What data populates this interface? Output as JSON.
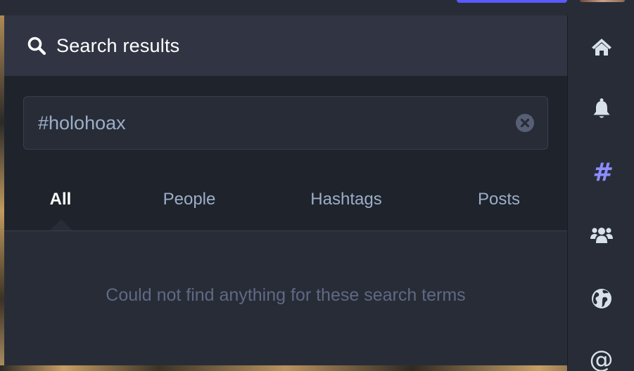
{
  "header": {
    "title": "Search results",
    "icon": "search-icon"
  },
  "search": {
    "value": "#holohoax",
    "clear_icon": "clear-icon"
  },
  "tabs": [
    {
      "label": "All",
      "active": true
    },
    {
      "label": "People",
      "active": false
    },
    {
      "label": "Hashtags",
      "active": false
    },
    {
      "label": "Posts",
      "active": false
    }
  ],
  "results": {
    "empty_message": "Could not find anything for these search terms"
  },
  "nav": {
    "items": [
      {
        "icon": "home-icon"
      },
      {
        "icon": "bell-icon"
      },
      {
        "icon": "hashtag-icon",
        "glyph": "#",
        "active": true
      },
      {
        "icon": "users-icon"
      },
      {
        "icon": "globe-icon"
      },
      {
        "icon": "at-icon",
        "glyph": "@"
      }
    ]
  },
  "colors": {
    "accent": "#8c8dff",
    "primary_button": "#595aff",
    "background": "#282c37",
    "header": "#313543",
    "muted_text": "#606984",
    "secondary_text": "#9baec8"
  }
}
